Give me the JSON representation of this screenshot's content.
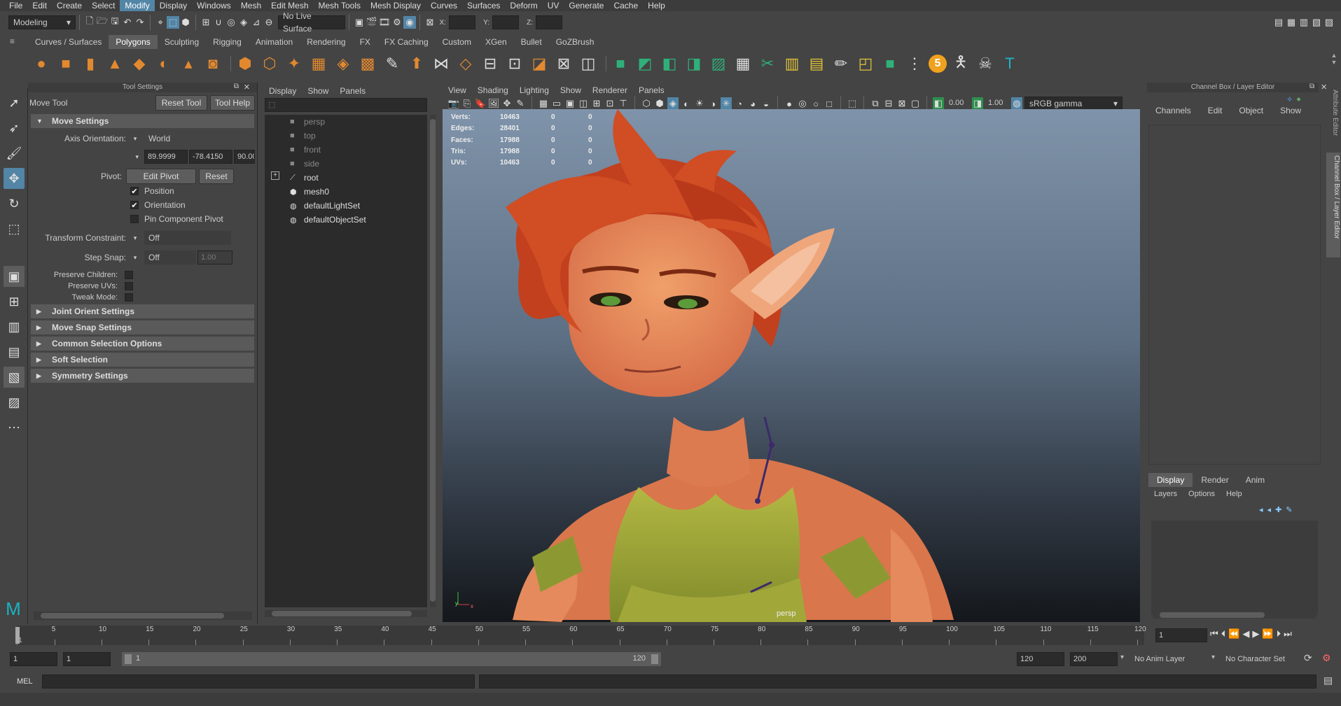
{
  "menubar": {
    "items": [
      "File",
      "Edit",
      "Create",
      "Select",
      "Modify",
      "Display",
      "Windows",
      "Mesh",
      "Edit Mesh",
      "Mesh Tools",
      "Mesh Display",
      "Curves",
      "Surfaces",
      "Deform",
      "UV",
      "Generate",
      "Cache",
      "Help"
    ],
    "active": "Modify"
  },
  "statusline": {
    "workspace": "Modeling",
    "live_surface": "No Live Surface",
    "x_label": "X:",
    "y_label": "Y:",
    "z_label": "Z:"
  },
  "shelf": {
    "tabs": [
      "Curves / Surfaces",
      "Polygons",
      "Sculpting",
      "Rigging",
      "Animation",
      "Rendering",
      "FX",
      "FX Caching",
      "Custom",
      "XGen",
      "Bullet",
      "GoZBrush"
    ],
    "active_tab": "Polygons",
    "badge_number": "5"
  },
  "tool_settings": {
    "panel_title": "Tool Settings",
    "tool_name": "Move Tool",
    "reset_tool": "Reset Tool",
    "tool_help": "Tool Help",
    "move_settings": "Move Settings",
    "axis_orientation_label": "Axis Orientation:",
    "axis_orientation_value": "World",
    "rot_x": "89.9999",
    "rot_y": "-78.4150",
    "rot_z": "90.00",
    "pivot_label": "Pivot:",
    "edit_pivot": "Edit Pivot",
    "reset": "Reset",
    "position": "Position",
    "orientation": "Orientation",
    "pin_component_pivot": "Pin Component Pivot",
    "transform_constraint_label": "Transform Constraint:",
    "transform_constraint_value": "Off",
    "step_snap_label": "Step Snap:",
    "step_snap_value": "Off",
    "step_snap_amount": "1.00",
    "preserve_children": "Preserve Children:",
    "preserve_uvs": "Preserve UVs:",
    "tweak_mode": "Tweak Mode:",
    "sections": [
      "Joint Orient Settings",
      "Move Snap Settings",
      "Common Selection Options",
      "Soft Selection",
      "Symmetry Settings"
    ]
  },
  "outliner": {
    "menus": [
      "Display",
      "Show",
      "Panels"
    ],
    "items": [
      {
        "label": "persp",
        "dim": true,
        "icon": "camera-icon"
      },
      {
        "label": "top",
        "dim": true,
        "icon": "camera-icon"
      },
      {
        "label": "front",
        "dim": true,
        "icon": "camera-icon"
      },
      {
        "label": "side",
        "dim": true,
        "icon": "camera-icon"
      },
      {
        "label": "root",
        "dim": false,
        "icon": "joint-icon"
      },
      {
        "label": "mesh0",
        "dim": false,
        "icon": "mesh-icon"
      },
      {
        "label": "defaultLightSet",
        "dim": false,
        "icon": "set-icon"
      },
      {
        "label": "defaultObjectSet",
        "dim": false,
        "icon": "set-icon"
      }
    ]
  },
  "viewport": {
    "menus": [
      "View",
      "Shading",
      "Lighting",
      "Show",
      "Renderer",
      "Panels"
    ],
    "exposure": "0.00",
    "gamma": "1.00",
    "color_space": "sRGB gamma",
    "camera_label": "persp",
    "hud": [
      {
        "label": "Verts:",
        "v1": "10463",
        "v2": "0",
        "v3": "0"
      },
      {
        "label": "Edges:",
        "v1": "28401",
        "v2": "0",
        "v3": "0"
      },
      {
        "label": "Faces:",
        "v1": "17988",
        "v2": "0",
        "v3": "0"
      },
      {
        "label": "Tris:",
        "v1": "17988",
        "v2": "0",
        "v3": "0"
      },
      {
        "label": "UVs:",
        "v1": "10463",
        "v2": "0",
        "v3": "0"
      }
    ]
  },
  "channel_box": {
    "title": "Channel Box / Layer Editor",
    "menus": [
      "Channels",
      "Edit",
      "Object",
      "Show"
    ],
    "layer_tabs": [
      "Display",
      "Render",
      "Anim"
    ],
    "active_layer_tab": "Display",
    "layer_menus": [
      "Layers",
      "Options",
      "Help"
    ],
    "side_tab_1": "Attribute Editor",
    "side_tab_2": "Channel Box / Layer Editor"
  },
  "timeline": {
    "ticks": [
      "1",
      "5",
      "10",
      "15",
      "20",
      "25",
      "30",
      "35",
      "40",
      "45",
      "50",
      "55",
      "60",
      "65",
      "70",
      "75",
      "80",
      "85",
      "90",
      "95",
      "100",
      "105",
      "110",
      "115",
      "120"
    ],
    "current_frame": "1",
    "range_start": "1",
    "range_inner_start": "1",
    "range_slider_start": "1",
    "range_slider_end": "120",
    "range_inner_end": "120",
    "range_end": "200",
    "anim_layer": "No Anim Layer",
    "character_set": "No Character Set"
  },
  "command_line": {
    "language": "MEL"
  }
}
